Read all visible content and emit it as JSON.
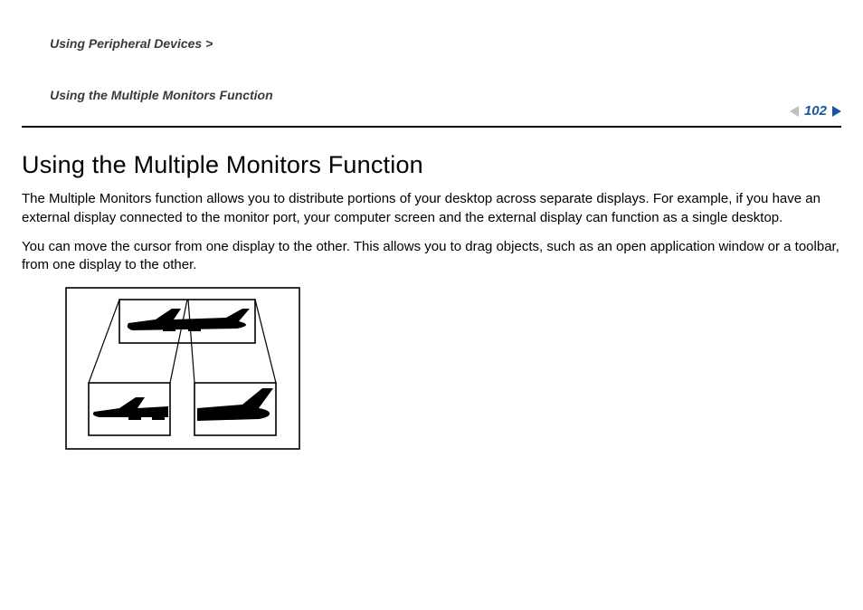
{
  "header": {
    "breadcrumb_section": "Using Peripheral Devices",
    "breadcrumb_sep": " > ",
    "breadcrumb_page": "Using the Multiple Monitors Function",
    "page_number": "102"
  },
  "main": {
    "title": "Using the Multiple Monitors Function",
    "para1": "The Multiple Monitors function allows you to distribute portions of your desktop across separate displays. For example, if you have an external display connected to the monitor port, your computer screen and the external display can function as a single desktop.",
    "para2": "You can move the cursor from one display to the other. This allows you to drag objects, such as an open application window or a toolbar, from one display to the other."
  },
  "illustration": {
    "alt": "Diagram of a single wide display split into two smaller displays showing front and rear halves of an airplane silhouette",
    "icons": [
      "airplane-icon",
      "airplane-front-icon",
      "airplane-tail-icon"
    ]
  }
}
